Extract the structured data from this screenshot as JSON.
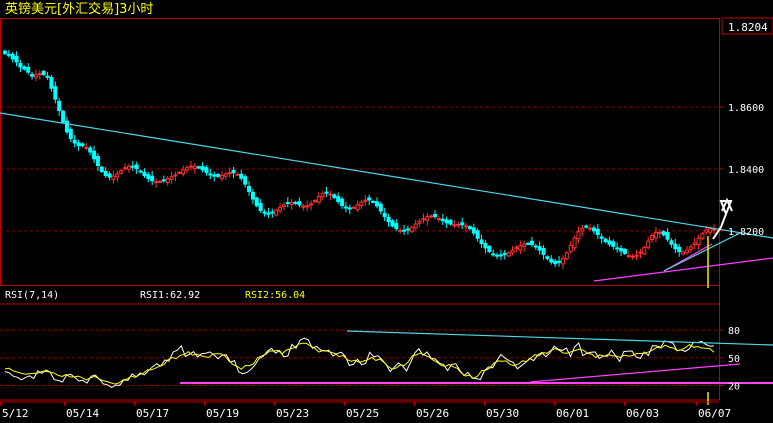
{
  "title": "英镑美元[外汇交易]3小时",
  "colors": {
    "background": "#000000",
    "frame": "#c00000",
    "grid": "#8b0000",
    "up_candle": "#ff3030",
    "down_candle": "#00ffff",
    "trend_cyan": "#4dd6e6",
    "trend_magenta": "#ff40ff",
    "rsi1": "#ffffff",
    "rsi2": "#ffff00",
    "title": "#ffff00",
    "axis_text": "#ffffff",
    "arrow": "#ffffff",
    "cursor": "#ffff00"
  },
  "current_price_label": "1.8204",
  "rsi_header": {
    "name": "RSI(7,14)",
    "rsi1": "RSI1:62.92",
    "rsi2": "RSI2:56.04"
  },
  "chart_data": [
    {
      "type": "candlestick",
      "title": "英镑美元[外汇交易]3小时",
      "y_ticks": [
        "1.8600",
        "1.8400",
        "1.8200"
      ],
      "y_tick_values": [
        1.86,
        1.84,
        1.82
      ],
      "ylim": [
        1.8025,
        1.8888
      ],
      "x_tick_labels": [
        "5/12",
        "05/14",
        "05/17",
        "05/19",
        "05/23",
        "05/25",
        "05/26",
        "05/30",
        "06/01",
        "06/03",
        "06/07"
      ],
      "grid": true,
      "series": [
        {
          "close": [
            1.8773,
            1.8768,
            1.8756,
            1.8746,
            1.873,
            1.8723,
            1.8713,
            1.87,
            1.8704,
            1.8708,
            1.8705,
            1.8696,
            1.8661,
            1.8626,
            1.8589,
            1.8552,
            1.852,
            1.8498,
            1.8484,
            1.8476,
            1.8475,
            1.847,
            1.8455,
            1.8433,
            1.8411,
            1.8392,
            1.8379,
            1.8374,
            1.8377,
            1.8384,
            1.8395,
            1.8404,
            1.8409,
            1.8408,
            1.8401,
            1.8391,
            1.8379,
            1.8369,
            1.8362,
            1.8359,
            1.836,
            1.8364,
            1.8369,
            1.8375,
            1.8381,
            1.8389,
            1.8397,
            1.8404,
            1.8409,
            1.8409,
            1.8405,
            1.8397,
            1.8389,
            1.8381,
            1.8377,
            1.8376,
            1.8379,
            1.8384,
            1.8388,
            1.8388,
            1.8383,
            1.837,
            1.8351,
            1.8327,
            1.8303,
            1.8281,
            1.8266,
            1.8257,
            1.8256,
            1.8259,
            1.8267,
            1.8276,
            1.8284,
            1.829,
            1.8292,
            1.8289,
            1.8284,
            1.828,
            1.8281,
            1.8287,
            1.8298,
            1.8311,
            1.832,
            1.8324,
            1.8319,
            1.8308,
            1.8295,
            1.8282,
            1.8274,
            1.8271,
            1.8276,
            1.8284,
            1.8293,
            1.8299,
            1.83,
            1.8294,
            1.8281,
            1.8264,
            1.8246,
            1.823,
            1.8216,
            1.8207,
            1.8202,
            1.8201,
            1.8205,
            1.8212,
            1.8222,
            1.8231,
            1.8239,
            1.8246,
            1.8248,
            1.8246,
            1.824,
            1.8233,
            1.8226,
            1.8222,
            1.822,
            1.8221,
            1.822,
            1.8216,
            1.8207,
            1.8193,
            1.8176,
            1.8159,
            1.8145,
            1.8133,
            1.8124,
            1.812,
            1.812,
            1.8124,
            1.8129,
            1.8137,
            1.8146,
            1.8152,
            1.8157,
            1.8159,
            1.8156,
            1.8149,
            1.8138,
            1.8124,
            1.811,
            1.8099,
            1.8094,
            1.8098,
            1.811,
            1.8129,
            1.8153,
            1.8177,
            1.8197,
            1.8208,
            1.8212,
            1.8209,
            1.82,
            1.8188,
            1.8176,
            1.8165,
            1.8157,
            1.815,
            1.8143,
            1.8135,
            1.8127,
            1.812,
            1.8118,
            1.8121,
            1.8131,
            1.8147,
            1.8167,
            1.8185,
            1.8195,
            1.8195,
            1.8187,
            1.8173,
            1.8157,
            1.8142,
            1.8133,
            1.8132,
            1.8138,
            1.8148,
            1.8161,
            1.8176,
            1.8191,
            1.8203,
            1.8207,
            1.8205
          ]
        }
      ]
    },
    {
      "type": "line",
      "title": "RSI(7,14)",
      "y_ticks": [
        "80",
        "50",
        "20"
      ],
      "y_tick_values": [
        80,
        50,
        20
      ],
      "ylim": [
        0,
        100
      ],
      "grid": true,
      "series": [
        {
          "name": "RSI1",
          "values": [
            35.1,
            33.8,
            30.2,
            28.9,
            26.2,
            28.6,
            30.5,
            27.6,
            35.9,
            33.1,
            36.8,
            34.6,
            26.4,
            25.4,
            23.8,
            31.0,
            32.2,
            28.9,
            24.9,
            25.6,
            22.6,
            30.0,
            31.3,
            27.1,
            21.7,
            20.8,
            18.0,
            20.2,
            20.3,
            26.1,
            25.5,
            32.6,
            29.4,
            33.5,
            31.6,
            36.0,
            40.4,
            43.6,
            40.9,
            47.6,
            46.4,
            56.2,
            58.2,
            63.0,
            51.4,
            53.8,
            56.6,
            50.9,
            54.5,
            55.0,
            56.4,
            53.0,
            48.9,
            52.9,
            53.3,
            45.4,
            47.0,
            34.7,
            32.8,
            34.0,
            37.4,
            42.2,
            49.2,
            51.5,
            57.0,
            60.3,
            55.1,
            57.8,
            51.2,
            52.0,
            64.5,
            60.4,
            68.9,
            71.4,
            69.4,
            60.4,
            62.4,
            58.6,
            57.2,
            58.2,
            52.0,
            54.4,
            56.1,
            51.7,
            41.7,
            43.0,
            48.5,
            42.6,
            43.7,
            56.1,
            51.0,
            52.3,
            48.1,
            42.7,
            35.1,
            39.8,
            44.5,
            41.2,
            35.8,
            45.1,
            55.3,
            59.7,
            52.8,
            56.3,
            49.5,
            48.7,
            44.2,
            42.6,
            36.2,
            42.9,
            43.5,
            36.4,
            30.7,
            34.1,
            27.9,
            27.6,
            26.5,
            36.2,
            40.1,
            39.2,
            46.9,
            53.6,
            49.7,
            46.9,
            45.1,
            38.1,
            41.5,
            44.8,
            49.4,
            47.0,
            53.3,
            55.6,
            51.2,
            55.4,
            62.6,
            59.3,
            58.0,
            60.5,
            51.5,
            61.7,
            66.0,
            52.5,
            55.0,
            56.0,
            56.4,
            49.3,
            52.0,
            51.8,
            58.3,
            52.2,
            46.1,
            56.7,
            57.2,
            57.4,
            50.9,
            49.3,
            56.3,
            52.5,
            63.2,
            62.9,
            61.5,
            68.3,
            67.1,
            65.8,
            57.8,
            58.7,
            56.9,
            59.7,
            66.8,
            66.4,
            67.7,
            64.4,
            62.7,
            62.9
          ]
        },
        {
          "name": "RSI2",
          "values": [
            38.0,
            38.6,
            35.8,
            34.6,
            33.2,
            32.3,
            32.8,
            33.3,
            33.2,
            35.2,
            35.4,
            34.5,
            33.6,
            31.1,
            29.8,
            31.9,
            29.2,
            29.3,
            30.2,
            28.3,
            26.2,
            28.5,
            29.8,
            27.3,
            25.3,
            24.4,
            22.8,
            21.5,
            22.9,
            26.2,
            27.1,
            30.3,
            28.9,
            31.8,
            33.5,
            37.1,
            37.0,
            39.1,
            41.1,
            42.5,
            48.1,
            50.3,
            49.0,
            52.7,
            53.6,
            56.7,
            52.8,
            53.9,
            52.4,
            51.2,
            50.3,
            54.0,
            54.5,
            54.2,
            51.9,
            46.5,
            42.5,
            40.7,
            37.7,
            41.7,
            41.4,
            43.6,
            50.2,
            52.1,
            53.9,
            57.4,
            57.4,
            58.0,
            54.2,
            58.3,
            59.6,
            60.9,
            64.7,
            65.8,
            65.6,
            62.6,
            60.5,
            56.2,
            57.9,
            57.5,
            55.8,
            54.6,
            51.3,
            52.5,
            47.9,
            46.3,
            47.4,
            44.9,
            46.5,
            47.8,
            50.4,
            47.2,
            48.6,
            45.1,
            40.7,
            37.8,
            39.0,
            42.2,
            41.7,
            45.8,
            52.3,
            53.2,
            55.2,
            52.9,
            51.0,
            47.7,
            45.4,
            41.9,
            40.7,
            42.8,
            40.3,
            38.6,
            33.5,
            30.3,
            31.2,
            27.7,
            30.3,
            36.3,
            36.6,
            38.9,
            44.4,
            46.6,
            46.3,
            46.6,
            42.6,
            41.4,
            43.2,
            46.8,
            45.9,
            49.5,
            53.4,
            51.9,
            55.6,
            54.9,
            58.0,
            60.1,
            58.2,
            55.2,
            55.0,
            56.6,
            58.0,
            59.2,
            58.1,
            54.8,
            54.0,
            50.4,
            53.2,
            51.7,
            53.6,
            52.3,
            51.7,
            50.5,
            52.8,
            51.7,
            52.5,
            54.7,
            54.7,
            54.9,
            56.5,
            58.6,
            61.5,
            60.5,
            63.6,
            61.6,
            60.6,
            57.6,
            58.8,
            61.0,
            64.3,
            61.4,
            62.2,
            60.6,
            60.4,
            59.8,
            56.0
          ]
        }
      ]
    }
  ]
}
